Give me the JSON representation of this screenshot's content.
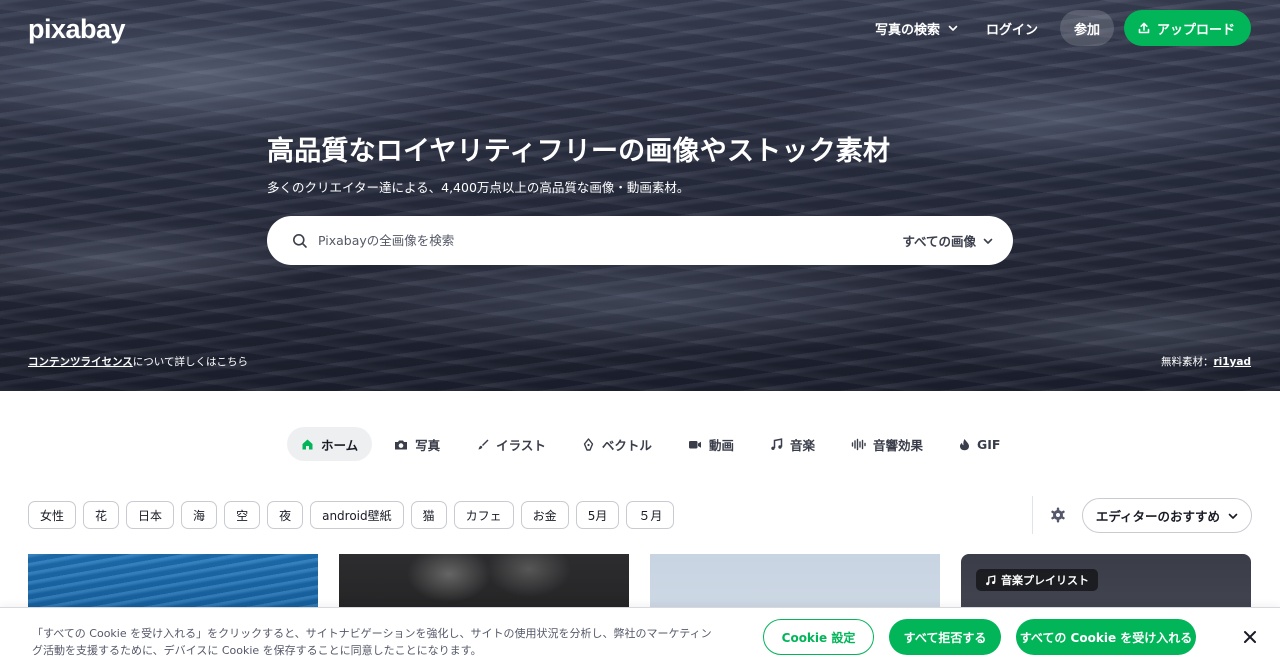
{
  "header": {
    "logo": "pixabay",
    "search_menu_label": "写真の検索",
    "login_label": "ログイン",
    "join_label": "参加",
    "upload_label": "アップロード"
  },
  "hero": {
    "title": "高品質なロイヤリティフリーの画像やストック素材",
    "subtitle": "多くのクリエイター達による、4,400万点以上の高品質な画像・動画素材。",
    "search": {
      "placeholder": "Pixabayの全画像を検索",
      "type_label": "すべての画像"
    },
    "license_link": "コンテンツライセンス",
    "license_suffix": "について詳しくはこちら",
    "credit_prefix": "無料素材：",
    "credit_user": "ri1yad"
  },
  "media_tabs": [
    {
      "label": "ホーム",
      "icon": "home-icon",
      "active": true
    },
    {
      "label": "写真",
      "icon": "camera-icon"
    },
    {
      "label": "イラスト",
      "icon": "brush-icon"
    },
    {
      "label": "ベクトル",
      "icon": "pen-nib-icon"
    },
    {
      "label": "動画",
      "icon": "video-icon"
    },
    {
      "label": "音楽",
      "icon": "music-note-icon"
    },
    {
      "label": "音響効果",
      "icon": "waveform-icon"
    },
    {
      "label": "GIF",
      "icon": "flame-icon"
    }
  ],
  "tag_chips": [
    "女性",
    "花",
    "日本",
    "海",
    "空",
    "夜",
    "android壁紙",
    "猫",
    "カフェ",
    "お金",
    "5月",
    "５月"
  ],
  "sort_label": "エディターのおすすめ",
  "cards": {
    "music_badge": "音楽プレイリスト"
  },
  "cookie": {
    "text": "「すべての Cookie を受け入れる」をクリックすると、サイトナビゲーションを強化し、サイトの使用状況を分析し、弊社のマーケティング活動を支援するために、デバイスに Cookie を保存することに同意したことになります。",
    "settings_label": "Cookie 設定",
    "reject_label": "すべて拒否する",
    "accept_label": "すべての Cookie を受け入れる"
  },
  "colors": {
    "accent_green": "#02b559",
    "text_dark": "#191b26"
  }
}
